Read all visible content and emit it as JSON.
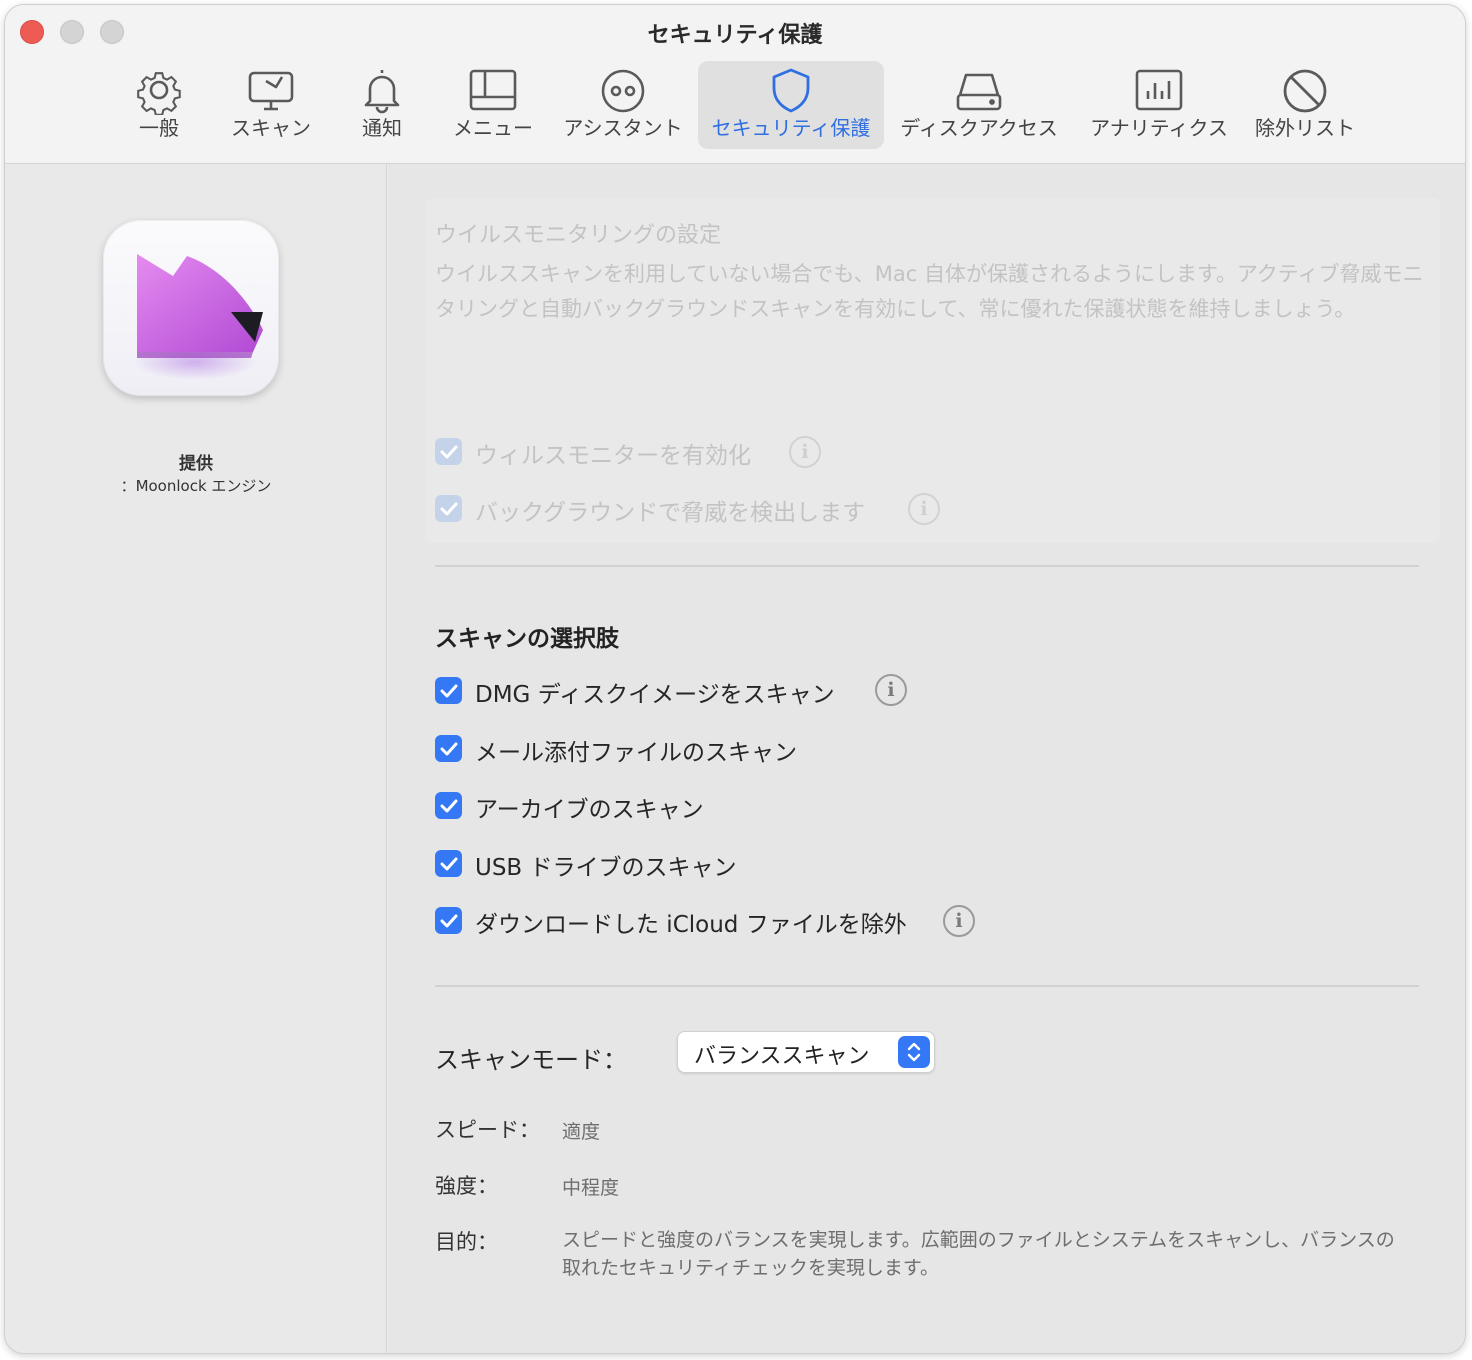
{
  "window": {
    "title": "セキュリティ保護"
  },
  "toolbar": {
    "tabs": [
      {
        "label": "一般",
        "icon": "gear-icon"
      },
      {
        "label": "スキャン",
        "icon": "scan-display-icon"
      },
      {
        "label": "通知",
        "icon": "bell-icon"
      },
      {
        "label": "メニュー",
        "icon": "menu-window-icon"
      },
      {
        "label": "アシスタント",
        "icon": "assistant-face-icon"
      },
      {
        "label": "セキュリティ保護",
        "icon": "shield-icon",
        "active": true
      },
      {
        "label": "ディスクアクセス",
        "icon": "disk-icon"
      },
      {
        "label": "アナリティクス",
        "icon": "analytics-chart-icon"
      },
      {
        "label": "除外リスト",
        "icon": "prohibited-icon"
      }
    ]
  },
  "sidebar": {
    "provider_label": "提供",
    "provider_name": "：Moonlock エンジン",
    "app_icon": "moonlock-app-icon"
  },
  "virus_monitoring": {
    "title": "ウイルスモニタリングの設定",
    "description": "ウイルススキャンを利用していない場合でも、Mac 自体が保護されるようにします。アクティブ脅威モニタリングと自動バックグラウンドスキャンを有効にして、常に優れた保護状態を維持しましょう。",
    "options": [
      {
        "label": "ウィルスモニターを有効化",
        "checked": true,
        "disabled": true,
        "info": true
      },
      {
        "label": "バックグラウンドで脅威を検出します",
        "checked": true,
        "disabled": true,
        "info": true
      }
    ]
  },
  "scan_options": {
    "title": "スキャンの選択肢",
    "options": [
      {
        "label": "DMG ディスクイメージをスキャン",
        "checked": true,
        "info": true
      },
      {
        "label": "メール添付ファイルのスキャン",
        "checked": true,
        "info": false
      },
      {
        "label": "アーカイブのスキャン",
        "checked": true,
        "info": false
      },
      {
        "label": "USB ドライブのスキャン",
        "checked": true,
        "info": false
      },
      {
        "label": "ダウンロードした iCloud ファイルを除外",
        "checked": true,
        "info": true
      }
    ]
  },
  "scan_mode": {
    "label": "スキャンモード：",
    "selected": "バランススキャン",
    "speed_label": "スピード：",
    "speed_value": "適度",
    "strength_label": "強度：",
    "strength_value": "中程度",
    "purpose_label": "目的：",
    "purpose_value": "スピードと強度のバランスを実現します。広範囲のファイルとシステムをスキャンし、バランスの取れたセキュリティチェックを実現します。"
  },
  "colors": {
    "accent": "#3478f6",
    "active_tab_text": "#2f6fe0",
    "close_button": "#ee5b55"
  }
}
